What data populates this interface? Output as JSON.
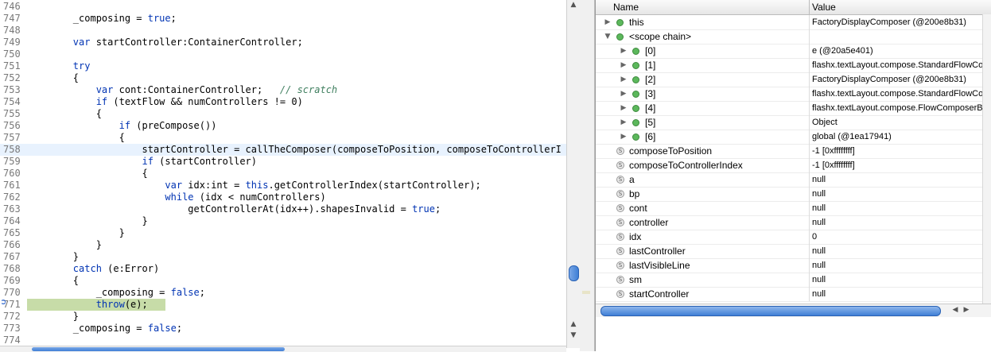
{
  "editor": {
    "lines": [
      {
        "n": "746",
        "parts": [
          {
            "t": ""
          }
        ]
      },
      {
        "n": "747",
        "parts": [
          {
            "t": "        _composing = "
          },
          {
            "t": "true",
            "k": 1
          },
          {
            "t": ";"
          }
        ]
      },
      {
        "n": "748",
        "parts": [
          {
            "t": ""
          }
        ]
      },
      {
        "n": "749",
        "parts": [
          {
            "t": "        "
          },
          {
            "t": "var",
            "k": 1
          },
          {
            "t": " startController:ContainerController;"
          }
        ]
      },
      {
        "n": "750",
        "parts": [
          {
            "t": ""
          }
        ]
      },
      {
        "n": "751",
        "parts": [
          {
            "t": "        "
          },
          {
            "t": "try",
            "k": 1
          }
        ]
      },
      {
        "n": "752",
        "parts": [
          {
            "t": "        {"
          }
        ]
      },
      {
        "n": "753",
        "parts": [
          {
            "t": "            "
          },
          {
            "t": "var",
            "k": 1
          },
          {
            "t": " cont:ContainerController;   "
          },
          {
            "t": "// scratch",
            "c": 1
          }
        ]
      },
      {
        "n": "754",
        "parts": [
          {
            "t": "            "
          },
          {
            "t": "if",
            "k": 1
          },
          {
            "t": " (textFlow && numControllers != 0)"
          }
        ]
      },
      {
        "n": "755",
        "parts": [
          {
            "t": "            {"
          }
        ]
      },
      {
        "n": "756",
        "parts": [
          {
            "t": "                "
          },
          {
            "t": "if",
            "k": 1
          },
          {
            "t": " (preCompose())"
          }
        ]
      },
      {
        "n": "757",
        "parts": [
          {
            "t": "                {"
          }
        ]
      },
      {
        "n": "758",
        "parts": [
          {
            "t": "                    startController = callTheComposer(composeToPosition, composeToControllerI"
          }
        ]
      },
      {
        "n": "759",
        "parts": [
          {
            "t": "                    "
          },
          {
            "t": "if",
            "k": 1
          },
          {
            "t": " (startController)"
          }
        ]
      },
      {
        "n": "760",
        "parts": [
          {
            "t": "                    {"
          }
        ]
      },
      {
        "n": "761",
        "parts": [
          {
            "t": "                        "
          },
          {
            "t": "var",
            "k": 1
          },
          {
            "t": " idx:int = "
          },
          {
            "t": "this",
            "k": 1
          },
          {
            "t": ".getControllerIndex(startController);"
          }
        ]
      },
      {
        "n": "762",
        "parts": [
          {
            "t": "                        "
          },
          {
            "t": "while",
            "k": 1
          },
          {
            "t": " (idx < numControllers)"
          }
        ]
      },
      {
        "n": "763",
        "parts": [
          {
            "t": "                            getControllerAt(idx++).shapesInvalid = "
          },
          {
            "t": "true",
            "k": 1
          },
          {
            "t": ";"
          }
        ]
      },
      {
        "n": "764",
        "parts": [
          {
            "t": "                    }"
          }
        ]
      },
      {
        "n": "765",
        "parts": [
          {
            "t": "                }"
          }
        ]
      },
      {
        "n": "766",
        "parts": [
          {
            "t": "            }"
          }
        ]
      },
      {
        "n": "767",
        "parts": [
          {
            "t": "        }"
          }
        ]
      },
      {
        "n": "768",
        "parts": [
          {
            "t": "        "
          },
          {
            "t": "catch",
            "k": 1
          },
          {
            "t": " (e:Error)"
          }
        ]
      },
      {
        "n": "769",
        "parts": [
          {
            "t": "        {"
          }
        ]
      },
      {
        "n": "770",
        "parts": [
          {
            "t": "            _composing = "
          },
          {
            "t": "false",
            "k": 1
          },
          {
            "t": ";"
          }
        ]
      },
      {
        "n": "771",
        "parts": [
          {
            "t": "            "
          },
          {
            "t": "throw",
            "k": 1
          },
          {
            "t": "(e);"
          }
        ]
      },
      {
        "n": "772",
        "parts": [
          {
            "t": "        }"
          }
        ]
      },
      {
        "n": "773",
        "parts": [
          {
            "t": "        _composing = "
          },
          {
            "t": "false",
            "k": 1
          },
          {
            "t": ";"
          }
        ]
      },
      {
        "n": "774",
        "parts": [
          {
            "t": ""
          }
        ]
      }
    ],
    "current_line": "758",
    "exec_line": "771"
  },
  "variables": {
    "header": {
      "name": "Name",
      "value": "Value"
    },
    "rows": [
      {
        "name": "this",
        "value": "FactoryDisplayComposer (@200e8b31)",
        "twisty": "▶",
        "icon": "green",
        "indent": 0
      },
      {
        "name": "<scope chain>",
        "value": "",
        "twisty": "▼",
        "icon": "green",
        "indent": 0
      },
      {
        "name": "[0]",
        "value": "e (@20a5e401)",
        "twisty": "▶",
        "icon": "green",
        "indent": 1
      },
      {
        "name": "[1]",
        "value": "flashx.textLayout.compose.StandardFlowComposer",
        "twisty": "▶",
        "icon": "green",
        "indent": 1
      },
      {
        "name": "[2]",
        "value": "FactoryDisplayComposer (@200e8b31)",
        "twisty": "▶",
        "icon": "green",
        "indent": 1
      },
      {
        "name": "[3]",
        "value": "flashx.textLayout.compose.StandardFlowComposer",
        "twisty": "▶",
        "icon": "green",
        "indent": 1
      },
      {
        "name": "[4]",
        "value": "flashx.textLayout.compose.FlowComposerBase",
        "twisty": "▶",
        "icon": "green",
        "indent": 1
      },
      {
        "name": "[5]",
        "value": "Object",
        "twisty": "▶",
        "icon": "green",
        "indent": 1
      },
      {
        "name": "[6]",
        "value": "global (@1ea17941)",
        "twisty": "▶",
        "icon": "green",
        "indent": 1
      },
      {
        "name": "composeToPosition",
        "value": "-1 [0xffffffff]",
        "twisty": "",
        "icon": "static",
        "indent": 0
      },
      {
        "name": "composeToControllerIndex",
        "value": "-1 [0xffffffff]",
        "twisty": "",
        "icon": "static",
        "indent": 0
      },
      {
        "name": "a",
        "value": "null",
        "twisty": "",
        "icon": "static",
        "indent": 0
      },
      {
        "name": "bp",
        "value": "null",
        "twisty": "",
        "icon": "static",
        "indent": 0
      },
      {
        "name": "cont",
        "value": "null",
        "twisty": "",
        "icon": "static",
        "indent": 0
      },
      {
        "name": "controller",
        "value": "null",
        "twisty": "",
        "icon": "static",
        "indent": 0
      },
      {
        "name": "idx",
        "value": "0",
        "twisty": "",
        "icon": "static",
        "indent": 0
      },
      {
        "name": "lastController",
        "value": "null",
        "twisty": "",
        "icon": "static",
        "indent": 0
      },
      {
        "name": "lastVisibleLine",
        "value": "null",
        "twisty": "",
        "icon": "static",
        "indent": 0
      },
      {
        "name": "sm",
        "value": "null",
        "twisty": "",
        "icon": "static",
        "indent": 0
      },
      {
        "name": "startController",
        "value": "null",
        "twisty": "",
        "icon": "static",
        "indent": 0
      }
    ]
  }
}
